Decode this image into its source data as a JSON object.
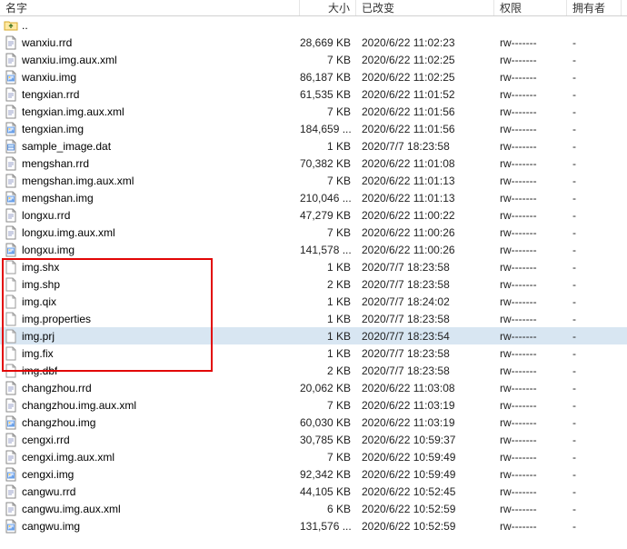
{
  "headers": {
    "name": "名字",
    "size": "大小",
    "date": "已改变",
    "perm": "权限",
    "owner": "拥有者"
  },
  "updir_label": "..",
  "rows": [
    {
      "name": "wanxiu.rrd",
      "icon": "doc",
      "size": "28,669 KB",
      "date": "2020/6/22 11:02:23",
      "perm": "rw-------",
      "owner": "-"
    },
    {
      "name": "wanxiu.img.aux.xml",
      "icon": "doc",
      "size": "7 KB",
      "date": "2020/6/22 11:02:25",
      "perm": "rw-------",
      "owner": "-"
    },
    {
      "name": "wanxiu.img",
      "icon": "img",
      "size": "86,187 KB",
      "date": "2020/6/22 11:02:25",
      "perm": "rw-------",
      "owner": "-"
    },
    {
      "name": "tengxian.rrd",
      "icon": "doc",
      "size": "61,535 KB",
      "date": "2020/6/22 11:01:52",
      "perm": "rw-------",
      "owner": "-"
    },
    {
      "name": "tengxian.img.aux.xml",
      "icon": "doc",
      "size": "7 KB",
      "date": "2020/6/22 11:01:56",
      "perm": "rw-------",
      "owner": "-"
    },
    {
      "name": "tengxian.img",
      "icon": "img",
      "size": "184,659 ...",
      "date": "2020/6/22 11:01:56",
      "perm": "rw-------",
      "owner": "-"
    },
    {
      "name": "sample_image.dat",
      "icon": "dat",
      "size": "1 KB",
      "date": "2020/7/7 18:23:58",
      "perm": "rw-------",
      "owner": "-"
    },
    {
      "name": "mengshan.rrd",
      "icon": "doc",
      "size": "70,382 KB",
      "date": "2020/6/22 11:01:08",
      "perm": "rw-------",
      "owner": "-"
    },
    {
      "name": "mengshan.img.aux.xml",
      "icon": "doc",
      "size": "7 KB",
      "date": "2020/6/22 11:01:13",
      "perm": "rw-------",
      "owner": "-"
    },
    {
      "name": "mengshan.img",
      "icon": "img",
      "size": "210,046 ...",
      "date": "2020/6/22 11:01:13",
      "perm": "rw-------",
      "owner": "-"
    },
    {
      "name": "longxu.rrd",
      "icon": "doc",
      "size": "47,279 KB",
      "date": "2020/6/22 11:00:22",
      "perm": "rw-------",
      "owner": "-"
    },
    {
      "name": "longxu.img.aux.xml",
      "icon": "doc",
      "size": "7 KB",
      "date": "2020/6/22 11:00:26",
      "perm": "rw-------",
      "owner": "-"
    },
    {
      "name": "longxu.img",
      "icon": "img",
      "size": "141,578 ...",
      "date": "2020/6/22 11:00:26",
      "perm": "rw-------",
      "owner": "-"
    },
    {
      "name": "img.shx",
      "icon": "blank",
      "size": "1 KB",
      "date": "2020/7/7 18:23:58",
      "perm": "rw-------",
      "owner": "-"
    },
    {
      "name": "img.shp",
      "icon": "blank",
      "size": "2 KB",
      "date": "2020/7/7 18:23:58",
      "perm": "rw-------",
      "owner": "-"
    },
    {
      "name": "img.qix",
      "icon": "blank",
      "size": "1 KB",
      "date": "2020/7/7 18:24:02",
      "perm": "rw-------",
      "owner": "-"
    },
    {
      "name": "img.properties",
      "icon": "blank",
      "size": "1 KB",
      "date": "2020/7/7 18:23:58",
      "perm": "rw-------",
      "owner": "-"
    },
    {
      "name": "img.prj",
      "icon": "blank",
      "size": "1 KB",
      "date": "2020/7/7 18:23:54",
      "perm": "rw-------",
      "owner": "-",
      "selected": true
    },
    {
      "name": "img.fix",
      "icon": "blank",
      "size": "1 KB",
      "date": "2020/7/7 18:23:58",
      "perm": "rw-------",
      "owner": "-"
    },
    {
      "name": "img.dbf",
      "icon": "blank",
      "size": "2 KB",
      "date": "2020/7/7 18:23:58",
      "perm": "rw-------",
      "owner": "-"
    },
    {
      "name": "changzhou.rrd",
      "icon": "doc",
      "size": "20,062 KB",
      "date": "2020/6/22 11:03:08",
      "perm": "rw-------",
      "owner": "-"
    },
    {
      "name": "changzhou.img.aux.xml",
      "icon": "doc",
      "size": "7 KB",
      "date": "2020/6/22 11:03:19",
      "perm": "rw-------",
      "owner": "-"
    },
    {
      "name": "changzhou.img",
      "icon": "img",
      "size": "60,030 KB",
      "date": "2020/6/22 11:03:19",
      "perm": "rw-------",
      "owner": "-"
    },
    {
      "name": "cengxi.rrd",
      "icon": "doc",
      "size": "30,785 KB",
      "date": "2020/6/22 10:59:37",
      "perm": "rw-------",
      "owner": "-"
    },
    {
      "name": "cengxi.img.aux.xml",
      "icon": "doc",
      "size": "7 KB",
      "date": "2020/6/22 10:59:49",
      "perm": "rw-------",
      "owner": "-"
    },
    {
      "name": "cengxi.img",
      "icon": "img",
      "size": "92,342 KB",
      "date": "2020/6/22 10:59:49",
      "perm": "rw-------",
      "owner": "-"
    },
    {
      "name": "cangwu.rrd",
      "icon": "doc",
      "size": "44,105 KB",
      "date": "2020/6/22 10:52:45",
      "perm": "rw-------",
      "owner": "-"
    },
    {
      "name": "cangwu.img.aux.xml",
      "icon": "doc",
      "size": "6 KB",
      "date": "2020/6/22 10:52:59",
      "perm": "rw-------",
      "owner": "-"
    },
    {
      "name": "cangwu.img",
      "icon": "img",
      "size": "131,576 ...",
      "date": "2020/6/22 10:52:59",
      "perm": "rw-------",
      "owner": "-"
    }
  ]
}
